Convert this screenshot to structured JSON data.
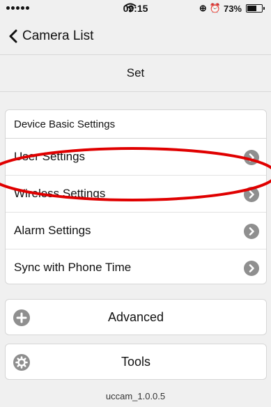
{
  "status_bar": {
    "time": "09:15",
    "battery_percent": "73%",
    "battery_level": 0.73,
    "icons": [
      "signal-dots-icon",
      "wifi-icon",
      "lock-rotation-icon",
      "alarm-icon",
      "battery-icon"
    ]
  },
  "nav": {
    "back_label": "Camera List",
    "title": "Set"
  },
  "settings_section": {
    "header": "Device Basic Settings",
    "items": [
      {
        "label": "User Settings"
      },
      {
        "label": "Wireless Settings"
      },
      {
        "label": "Alarm Settings"
      },
      {
        "label": "Sync with Phone Time"
      }
    ]
  },
  "advanced": {
    "label": "Advanced",
    "icon": "plus-circle-icon"
  },
  "tools": {
    "label": "Tools",
    "icon": "gear-icon"
  },
  "version": "uccam_1.0.0.5",
  "colors": {
    "background": "#f0f0f0",
    "card": "#ffffff",
    "chevron_circle": "#8f8f8f",
    "annotation": "#e00000"
  }
}
